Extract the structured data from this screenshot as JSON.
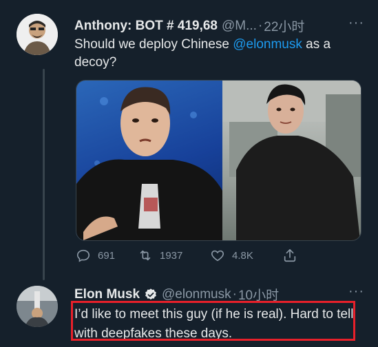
{
  "tweet": {
    "display_name": "Anthony: BOT # 419,68",
    "handle": "@M...",
    "separator": "·",
    "time": "22小时",
    "more": "···",
    "text_before": "Should we deploy Chinese ",
    "mention": "@elonmusk",
    "text_after": " as a decoy?",
    "stats": {
      "replies": "691",
      "retweets": "1937",
      "likes": "4.8K"
    },
    "icons": {
      "reply": "reply-icon",
      "retweet": "retweet-icon",
      "like": "heart-icon",
      "share": "share-icon"
    }
  },
  "reply": {
    "display_name": "Elon Musk",
    "handle": "@elonmusk",
    "separator": "·",
    "time": "10小时",
    "more": "···",
    "text": "I’d like to meet this guy (if he is real). Hard to tell with deepfakes these days."
  },
  "colors": {
    "background": "#15202b",
    "mention": "#1d9bf0",
    "highlight": "#e8202a",
    "verified": "#1d9bf0"
  }
}
